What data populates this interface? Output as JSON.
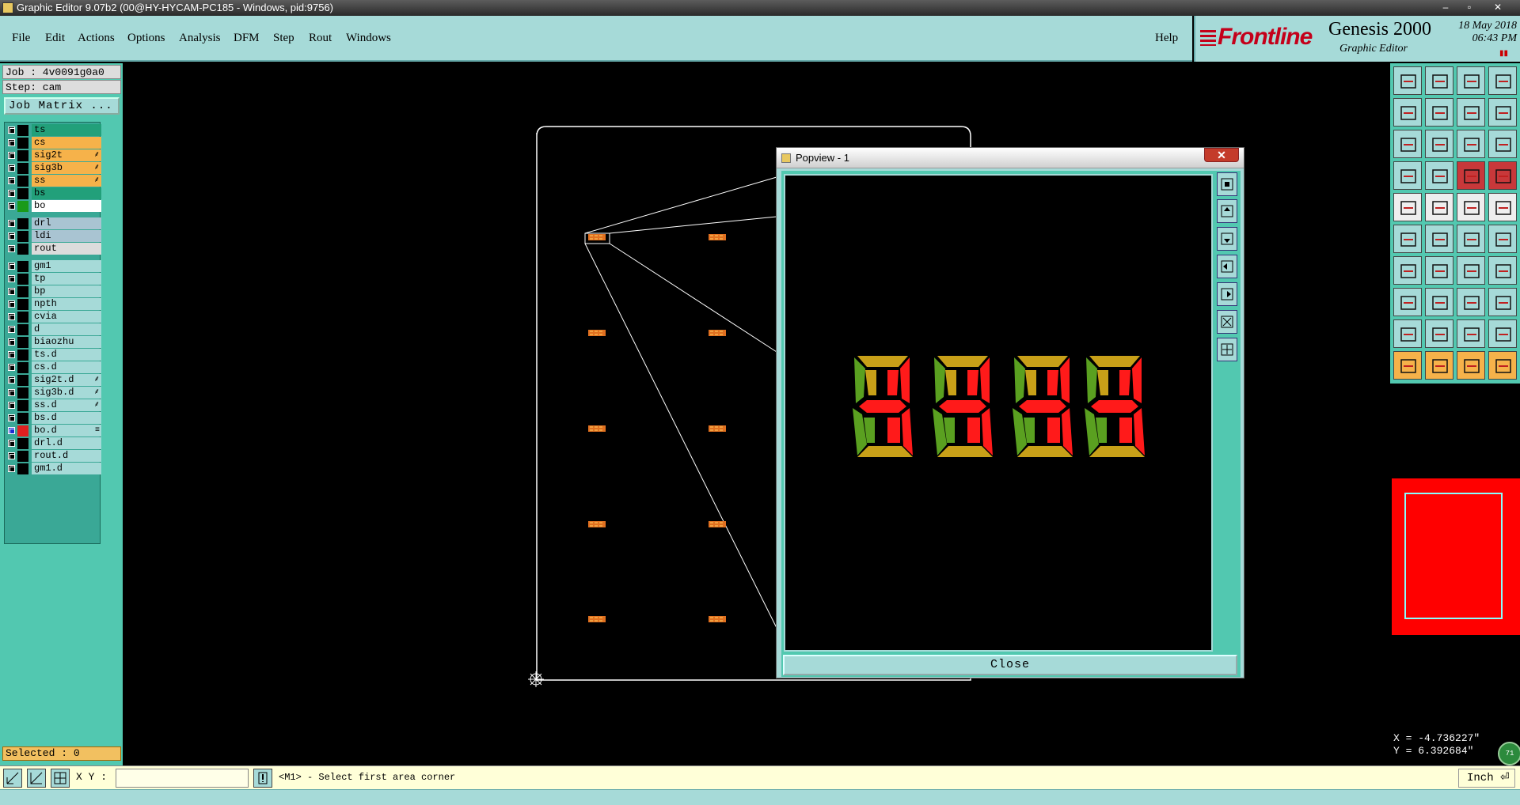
{
  "window": {
    "title": "Graphic Editor 9.07b2 (00@HY-HYCAM-PC185 - Windows, pid:9756)",
    "controls": [
      "–",
      "▫",
      "✕"
    ]
  },
  "menu": {
    "items": [
      {
        "label": "File"
      },
      {
        "label": "Edit"
      },
      {
        "label": "Actions"
      },
      {
        "label": "Options"
      },
      {
        "label": "Analysis"
      },
      {
        "label": "DFM"
      },
      {
        "label": "Step"
      },
      {
        "label": "Rout"
      },
      {
        "label": "Windows"
      }
    ],
    "help": "Help"
  },
  "brand": {
    "logo": "Frontline",
    "product": "Genesis 2000",
    "subtitle": "Graphic Editor",
    "date": "18 May 2018",
    "time": "06:43 PM"
  },
  "job": {
    "job_label": "Job : 4v0091g0a0",
    "step_label": "Step: cam",
    "matrix_button": "Job Matrix ..."
  },
  "layers": [
    {
      "name": "ts",
      "bg": "#22a07a",
      "mark": ""
    },
    {
      "name": "cs",
      "bg": "#f6b24a",
      "mark": ""
    },
    {
      "name": "sig2t",
      "bg": "#f6b24a",
      "mark": "⸙"
    },
    {
      "name": "sig3b",
      "bg": "#f6b24a",
      "mark": "⸙"
    },
    {
      "name": "ss",
      "bg": "#f6b24a",
      "mark": "⸙"
    },
    {
      "name": "bs",
      "bg": "#22a07a",
      "mark": ""
    },
    {
      "name": "bo",
      "bg": "#ffffff",
      "mark": "",
      "color": "#1a9a1a"
    },
    {
      "name": "drl",
      "bg": "#a9c4d2",
      "mark": ""
    },
    {
      "name": "ldi",
      "bg": "#a9c4d2",
      "mark": ""
    },
    {
      "name": "rout",
      "bg": "#dcdcdc",
      "mark": ""
    },
    {
      "name": "gm1",
      "bg": "#a6dad8",
      "mark": ""
    },
    {
      "name": "tp",
      "bg": "#a6dad8",
      "mark": ""
    },
    {
      "name": "bp",
      "bg": "#a6dad8",
      "mark": ""
    },
    {
      "name": "npth",
      "bg": "#a6dad8",
      "mark": ""
    },
    {
      "name": "cvia",
      "bg": "#a6dad8",
      "mark": ""
    },
    {
      "name": "d",
      "bg": "#a6dad8",
      "mark": ""
    },
    {
      "name": "biaozhu",
      "bg": "#a6dad8",
      "mark": ""
    },
    {
      "name": "ts.d",
      "bg": "#a6dad8",
      "mark": ""
    },
    {
      "name": "cs.d",
      "bg": "#a6dad8",
      "mark": ""
    },
    {
      "name": "sig2t.d",
      "bg": "#a6dad8",
      "mark": "⸙"
    },
    {
      "name": "sig3b.d",
      "bg": "#a6dad8",
      "mark": "⸙"
    },
    {
      "name": "ss.d",
      "bg": "#a6dad8",
      "mark": "⸙"
    },
    {
      "name": "bs.d",
      "bg": "#a6dad8",
      "mark": ""
    },
    {
      "name": "bo.d",
      "bg": "#a6dad8",
      "mark": "≡",
      "color": "#e02020",
      "checked": true
    },
    {
      "name": "drl.d",
      "bg": "#a6dad8",
      "mark": ""
    },
    {
      "name": "rout.d",
      "bg": "#a6dad8",
      "mark": ""
    },
    {
      "name": "gm1.d",
      "bg": "#a6dad8",
      "mark": ""
    }
  ],
  "selected": "Selected : 0",
  "popview": {
    "title": "Popview - 1",
    "close_button": "Close",
    "digit_text": "8888"
  },
  "coordinates": {
    "x": "X = -4.736227\"",
    "y": "Y = 6.392684\"",
    "badge": "71"
  },
  "status": {
    "xy_label": "X Y :",
    "xy_value": "",
    "message": "<M1> - Select first area corner",
    "unit": "Inch"
  },
  "colors": {
    "panel": "#52c8b0",
    "menu": "#a6dad8",
    "highlight": "#f6b24a",
    "brand_red": "#c4001a"
  }
}
